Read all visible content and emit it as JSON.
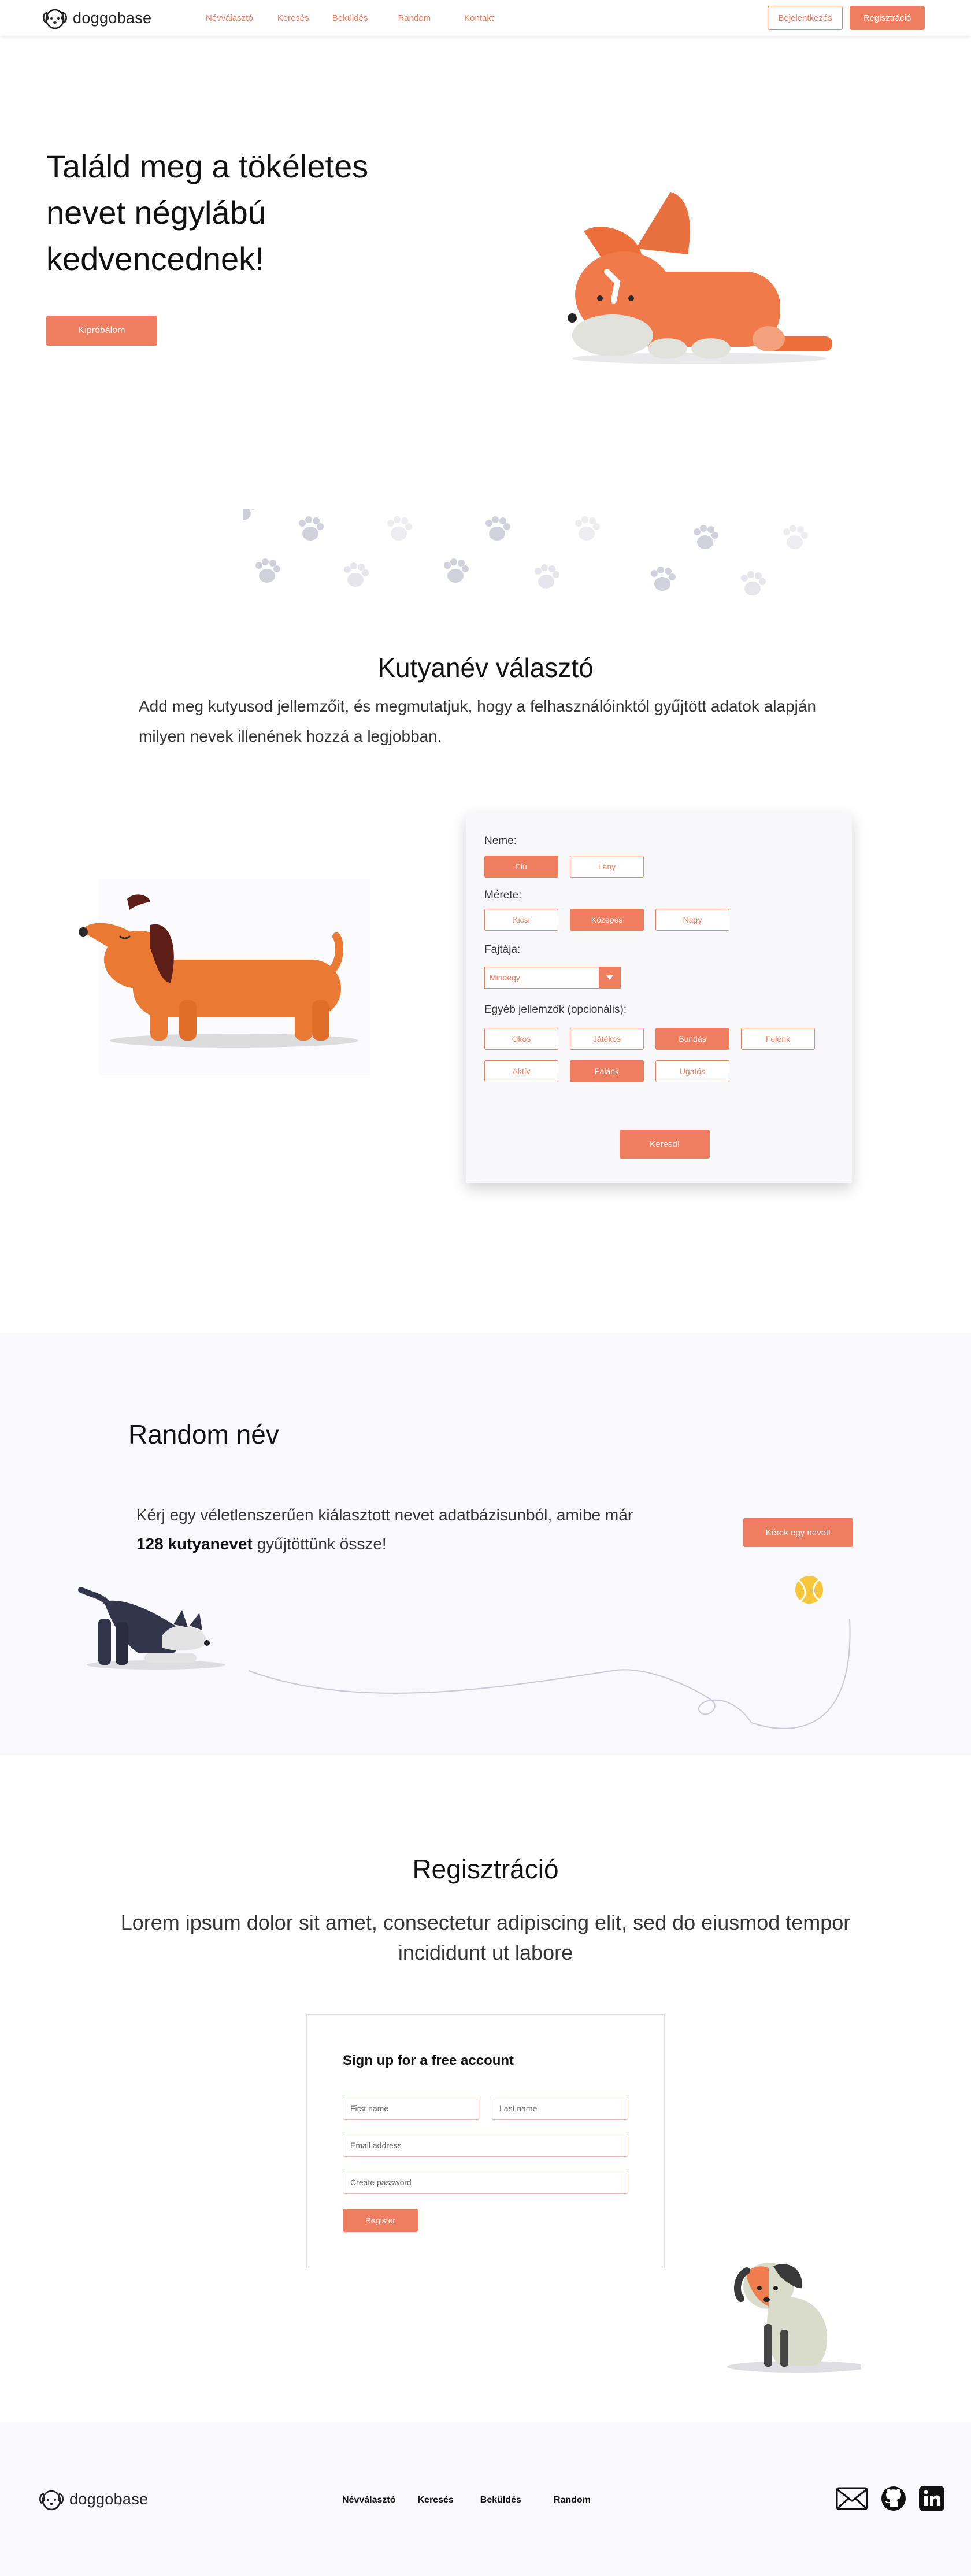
{
  "nav": {
    "brand": "doggobase",
    "links": [
      "Névválasztó",
      "Keresés",
      "Beküldés",
      "Random",
      "Kontakt"
    ],
    "login": "Bejelentkezés",
    "register": "Regisztráció"
  },
  "hero": {
    "title": "Találd meg a tökéletes nevet négylábú kedvencednek!",
    "cta": "Kipróbálom"
  },
  "picker": {
    "title": "Kutyanév választó",
    "description": "Add meg kutyusod jellemzőit, és megmutatjuk, hogy a felhasználóinktól gyűjtött adatok alapján milyen nevek illenének hozzá a legjobban.",
    "sex_label": "Neme:",
    "sex_options": [
      {
        "label": "Fiú",
        "selected": true
      },
      {
        "label": "Lány",
        "selected": false
      }
    ],
    "size_label": "Mérete:",
    "size_options": [
      {
        "label": "Kicsi",
        "selected": false
      },
      {
        "label": "Közepes",
        "selected": true
      },
      {
        "label": "Nagy",
        "selected": false
      }
    ],
    "breed_label": "Fajtája:",
    "breed_value": "Mindegy",
    "traits_label": "Egyéb jellemzők (opcionális):",
    "traits": [
      {
        "label": "Okos",
        "selected": false
      },
      {
        "label": "Játékos",
        "selected": false
      },
      {
        "label": "Bundás",
        "selected": true
      },
      {
        "label": "Felénk",
        "selected": false
      },
      {
        "label": "Aktív",
        "selected": false
      },
      {
        "label": "Falánk",
        "selected": true
      },
      {
        "label": "Ugatós",
        "selected": false
      }
    ],
    "search": "Keresd!"
  },
  "random": {
    "title": "Random név",
    "desc_before": "Kérj egy véletlenszerűen kiálasztott nevet adatbázisunból, amibe már",
    "desc_bold": "128 kutyanevet",
    "desc_after": "gyűjtöttünk össze!",
    "button": "Kérek egy nevet!"
  },
  "registration": {
    "title": "Regisztráció",
    "subtitle": "Lorem ipsum dolor sit amet, consectetur adipiscing elit, sed do eiusmod tempor incididunt ut labore",
    "form_title": "Sign up for a free account",
    "first_name": "First name",
    "last_name": "Last name",
    "email": "Email address",
    "password": "Create password",
    "submit": "Register"
  },
  "footer": {
    "brand": "doggobase",
    "links": [
      "Névválasztó",
      "Keresés",
      "Beküldés",
      "Random"
    ]
  },
  "colors": {
    "accent": "#ef7d5f",
    "soft_bg": "#f8f8fd"
  },
  "icons": [
    "dog-logo-icon",
    "paw-icon",
    "chevron-down-icon",
    "mail-icon",
    "github-icon",
    "linkedin-icon",
    "tennis-ball-icon"
  ]
}
